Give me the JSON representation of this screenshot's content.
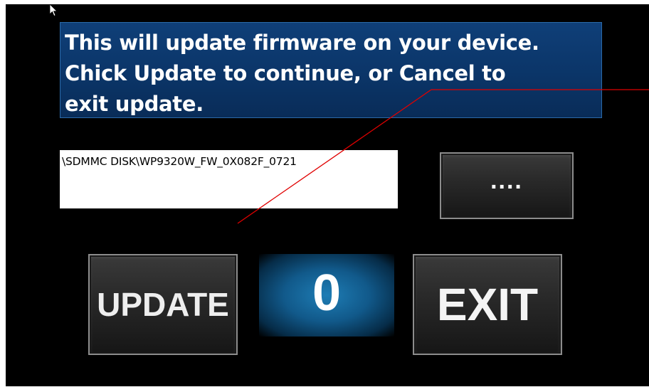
{
  "dialog": {
    "message": "This will update firmware on your device.\nChick Update to continue, or Cancel to\nexit update.",
    "file_path": "\\SDMMC DISK\\WP9320W_FW_0X082F_0721"
  },
  "buttons": {
    "browse_label": "....",
    "update_label": "UPDATE",
    "exit_label": "EXIT"
  },
  "progress": {
    "value": "0"
  },
  "icons": {
    "cursor": "mouse-pointer-icon"
  },
  "colors": {
    "background": "#000000",
    "banner": "#0b3568",
    "counter_glow": "#1e7db5",
    "annotation_line": "#e00000"
  }
}
